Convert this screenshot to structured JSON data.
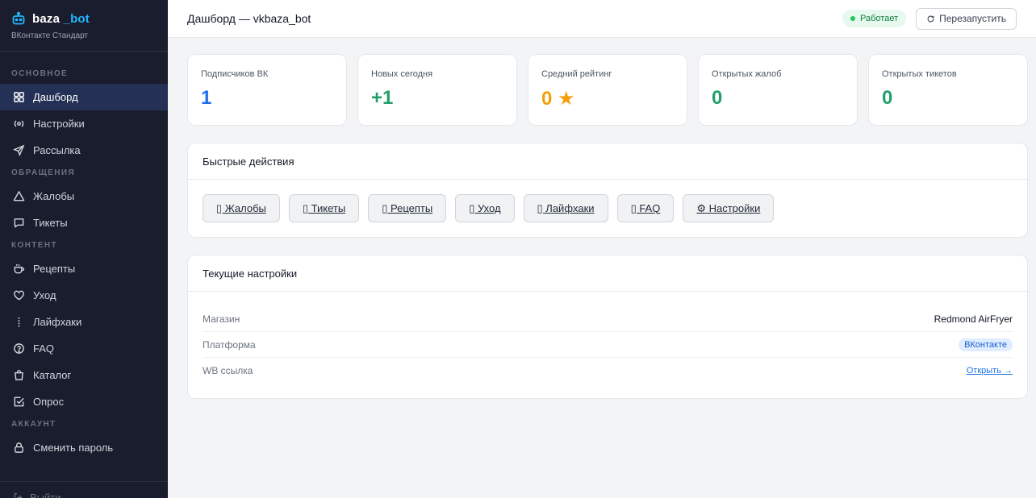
{
  "brand": {
    "name_part1": "baza",
    "name_part2": "_bot",
    "subtitle": "ВКонтакте Стандарт"
  },
  "sidebar": {
    "sections": [
      {
        "title": "ОСНОВНОЕ",
        "items": [
          {
            "label": "Дашборд",
            "icon": "grid-icon",
            "active": true
          },
          {
            "label": "Настройки",
            "icon": "radio-waves-icon"
          },
          {
            "label": "Рассылка",
            "icon": "paper-plane-icon"
          }
        ]
      },
      {
        "title": "ОБРАЩЕНИЯ",
        "items": [
          {
            "label": "Жалобы",
            "icon": "warning-triangle-icon"
          },
          {
            "label": "Тикеты",
            "icon": "chat-bubble-icon"
          }
        ]
      },
      {
        "title": "КОНТЕНТ",
        "items": [
          {
            "label": "Рецепты",
            "icon": "cup-icon"
          },
          {
            "label": "Уход",
            "icon": "heart-icon"
          },
          {
            "label": "Лайфхаки",
            "icon": "dotted-line-icon"
          },
          {
            "label": "FAQ",
            "icon": "question-circle-icon"
          },
          {
            "label": "Каталог",
            "icon": "shopping-bag-icon"
          },
          {
            "label": "Опрос",
            "icon": "check-square-icon"
          }
        ]
      },
      {
        "title": "АККАУНТ",
        "items": [
          {
            "label": "Сменить пароль",
            "icon": "lock-icon"
          }
        ]
      }
    ],
    "logout_label": "Выйти"
  },
  "header": {
    "title": "Дашборд — vkbaza_bot",
    "status": "Работает",
    "restart_label": "Перезапустить"
  },
  "stats": [
    {
      "label": "Подписчиков ВК",
      "value": "1",
      "color": "#1d72e8"
    },
    {
      "label": "Новых сегодня",
      "value": "+1",
      "color": "#22a06b"
    },
    {
      "label": "Средний рейтинг",
      "value": "0 ★",
      "color": "#f59e0b"
    },
    {
      "label": "Открытых жалоб",
      "value": "0",
      "color": "#22a06b"
    },
    {
      "label": "Открытых тикетов",
      "value": "0",
      "color": "#22a06b"
    }
  ],
  "quick_actions": {
    "title": "Быстрые действия",
    "buttons": [
      {
        "label": "▯ Жалобы"
      },
      {
        "label": "▯ Тикеты"
      },
      {
        "label": "▯ Рецепты"
      },
      {
        "label": "▯ Уход"
      },
      {
        "label": "▯ Лайфхаки"
      },
      {
        "label": "▯ FAQ"
      },
      {
        "label": "⚙ Настройки"
      }
    ]
  },
  "current_settings": {
    "title": "Текущие настройки",
    "rows": [
      {
        "key": "Магазин",
        "value": "Redmond AirFryer"
      },
      {
        "key": "Платформа",
        "value": "ВКонтакте"
      },
      {
        "key": "WB ссылка",
        "value": "Открыть →"
      }
    ]
  }
}
